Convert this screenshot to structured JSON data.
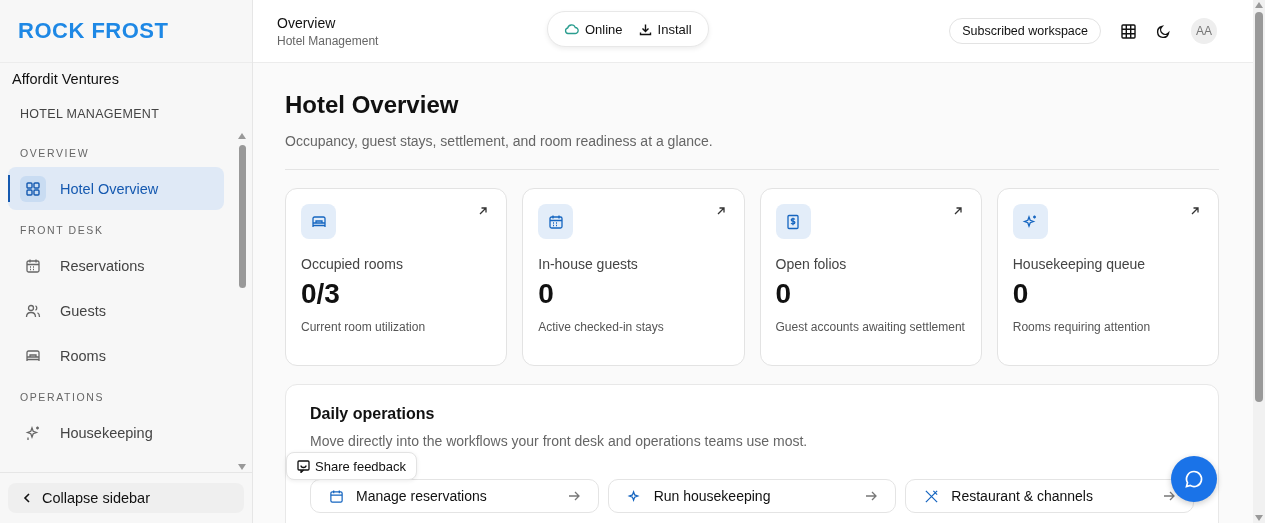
{
  "logo": {
    "text": "ROCK FROST"
  },
  "header": {
    "title": "Overview",
    "subtitle": "Hotel Management",
    "status": "Online",
    "install": "Install",
    "workspace": "Subscribed workspace",
    "avatar": "AA"
  },
  "sidebar": {
    "organization": "Affordit Ventures",
    "module": "HOTEL MANAGEMENT",
    "sections": [
      {
        "label": "OVERVIEW",
        "items": [
          {
            "label": "Hotel Overview",
            "selected": true
          }
        ]
      },
      {
        "label": "FRONT DESK",
        "items": [
          {
            "label": "Reservations",
            "selected": false
          },
          {
            "label": "Guests",
            "selected": false
          },
          {
            "label": "Rooms",
            "selected": false
          }
        ]
      },
      {
        "label": "OPERATIONS",
        "items": [
          {
            "label": "Housekeeping",
            "selected": false
          }
        ]
      }
    ],
    "collapse": "Collapse sidebar"
  },
  "page": {
    "title": "Hotel Overview",
    "subtitle": "Occupancy, guest stays, settlement, and room readiness at a glance."
  },
  "stats": [
    {
      "label": "Occupied rooms",
      "value": "0/3",
      "note": "Current room utilization"
    },
    {
      "label": "In-house guests",
      "value": "0",
      "note": "Active checked-in stays"
    },
    {
      "label": "Open folios",
      "value": "0",
      "note": "Guest accounts awaiting settlement"
    },
    {
      "label": "Housekeeping queue",
      "value": "0",
      "note": "Rooms requiring attention"
    }
  ],
  "daily": {
    "title": "Daily operations",
    "subtitle": "Move directly into the workflows your front desk and operations teams use most.",
    "actions": [
      "Manage reservations",
      "Run housekeeping",
      "Restaurant & channels"
    ]
  },
  "feedback": "Share feedback"
}
